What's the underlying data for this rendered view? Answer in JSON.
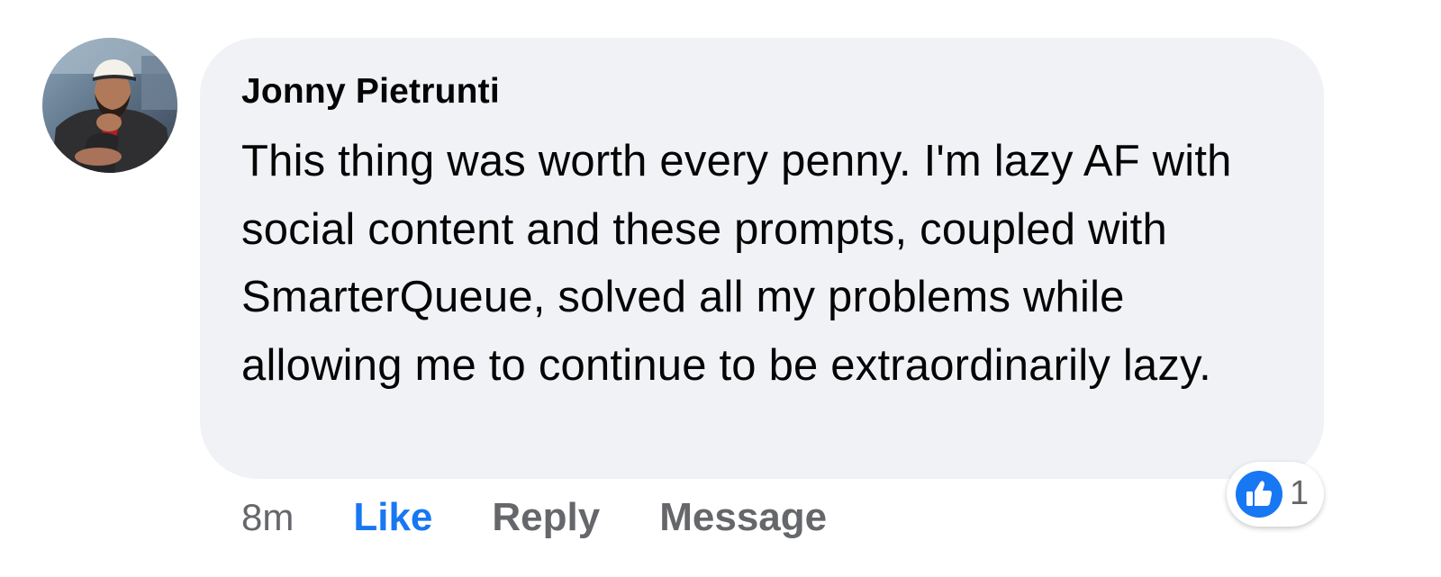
{
  "comment": {
    "author": "Jonny Pietrunti",
    "text": "This thing was worth every penny. I'm lazy AF with social content and these prompts, coupled with SmarterQueue, solved all my problems while allowing me to continue to be extraordinarily lazy.",
    "timestamp": "8m",
    "actions": {
      "like": "Like",
      "reply": "Reply",
      "message": "Message"
    },
    "reaction": {
      "icon": "thumbs-up-icon",
      "count": "1"
    }
  },
  "colors": {
    "bubble_bg": "#f0f2f5",
    "text": "#050505",
    "secondary": "#65676b",
    "like_blue": "#1877f2"
  }
}
